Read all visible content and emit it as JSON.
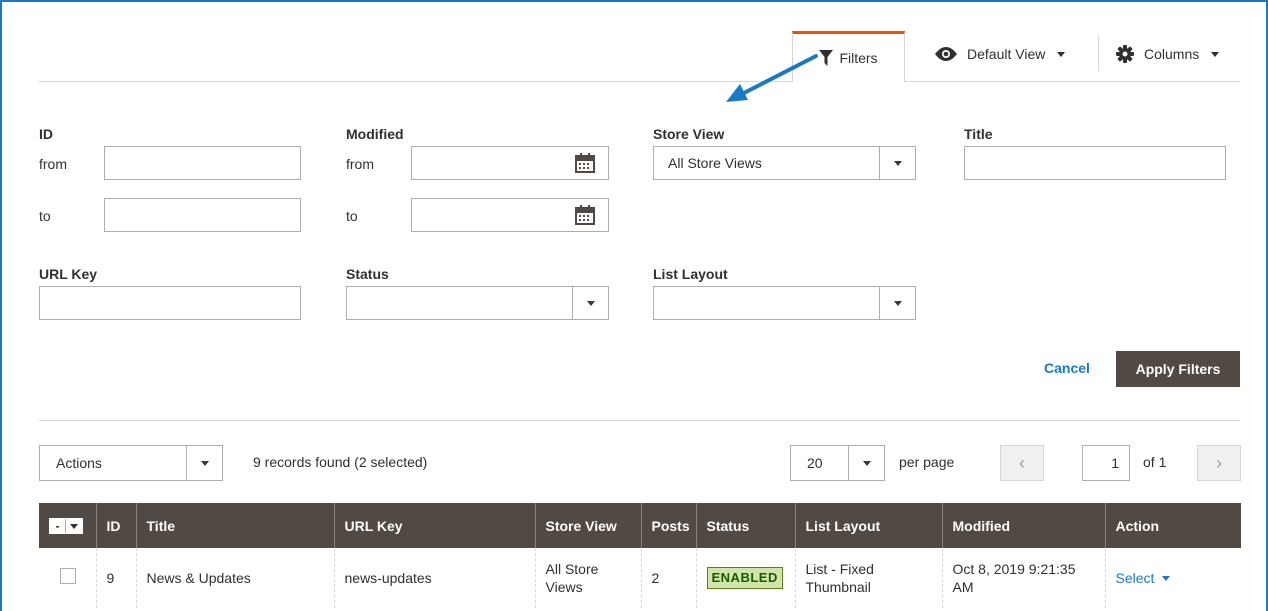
{
  "toolbar": {
    "filters_label": "Filters",
    "view_label": "Default View",
    "columns_label": "Columns"
  },
  "filters": {
    "id": {
      "label": "ID",
      "from_label": "from",
      "to_label": "to",
      "from_value": "",
      "to_value": ""
    },
    "modified": {
      "label": "Modified",
      "from_label": "from",
      "to_label": "to",
      "from_value": "",
      "to_value": ""
    },
    "store_view": {
      "label": "Store View",
      "value": "All Store Views"
    },
    "title": {
      "label": "Title",
      "value": ""
    },
    "url_key": {
      "label": "URL Key",
      "value": ""
    },
    "status": {
      "label": "Status",
      "value": ""
    },
    "list_layout": {
      "label": "List Layout",
      "value": ""
    },
    "cancel_label": "Cancel",
    "apply_label": "Apply Filters"
  },
  "grid_toolbar": {
    "actions_label": "Actions",
    "records_text": "9 records found (2 selected)",
    "per_page_value": "20",
    "per_page_label": "per page",
    "page_value": "1",
    "page_total": "of 1",
    "prev_icon": "‹",
    "next_icon": "›"
  },
  "table": {
    "headers": [
      "ID",
      "Title",
      "URL Key",
      "Store View",
      "Posts",
      "Status",
      "List Layout",
      "Modified",
      "Action"
    ],
    "rows": [
      {
        "id": "9",
        "title": "News & Updates",
        "url_key": "news-updates",
        "store_view": "All Store Views",
        "posts": "2",
        "status": "ENABLED",
        "list_layout": "List - Fixed Thumbnail",
        "modified": "Oct 8, 2019 9:21:35 AM",
        "action": "Select"
      }
    ]
  },
  "colors": {
    "accent_orange": "#eb5202",
    "header_bg": "#514943",
    "link_blue": "#1979c3",
    "arrow_blue": "#1979c3"
  }
}
